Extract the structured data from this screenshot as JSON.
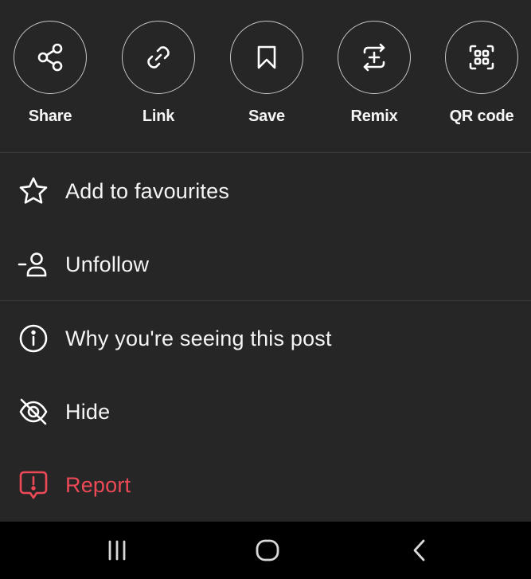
{
  "actions": [
    {
      "label": "Share",
      "icon": "share-icon"
    },
    {
      "label": "Link",
      "icon": "link-icon"
    },
    {
      "label": "Save",
      "icon": "bookmark-icon"
    },
    {
      "label": "Remix",
      "icon": "remix-icon"
    },
    {
      "label": "QR code",
      "icon": "qr-code-icon"
    }
  ],
  "menu": [
    {
      "label": "Add to favourites",
      "icon": "star-icon"
    },
    {
      "label": "Unfollow",
      "icon": "unfollow-icon"
    },
    {
      "label": "Why you're seeing this post",
      "icon": "info-icon"
    },
    {
      "label": "Hide",
      "icon": "eye-off-icon"
    },
    {
      "label": "Report",
      "icon": "report-icon",
      "color": "#ed4956"
    }
  ],
  "navbar": {
    "items": [
      "recent-apps-icon",
      "home-icon",
      "back-icon"
    ]
  },
  "colors": {
    "background": "#262626",
    "text": "#f5f5f5",
    "danger": "#ed4956",
    "navbar": "#000000"
  }
}
